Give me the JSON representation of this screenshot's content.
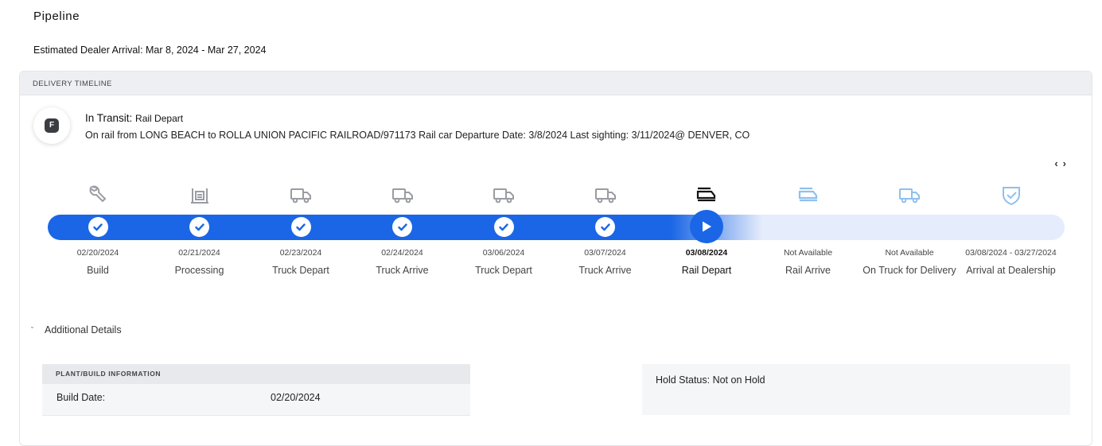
{
  "page": {
    "title": "Pipeline",
    "eta": "Estimated Dealer Arrival: Mar 8, 2024 - Mar 27, 2024"
  },
  "timeline": {
    "header": "DELIVERY TIMELINE",
    "status_letter": "F",
    "status_prefix": "In Transit:",
    "status_value": "Rail Depart",
    "status_detail": "On rail from LONG BEACH to ROLLA UNION PACIFIC RAILROAD/971173 Rail car Departure Date: 3/8/2024 Last sighting: 3/11/2024@ DENVER, CO",
    "nav": {
      "prev": "‹",
      "next": "›"
    },
    "steps": [
      {
        "date": "02/20/2024",
        "label": "Build",
        "state": "done",
        "icon": "wrench-icon"
      },
      {
        "date": "02/21/2024",
        "label": "Processing",
        "state": "done",
        "icon": "lift-icon"
      },
      {
        "date": "02/23/2024",
        "label": "Truck Depart",
        "state": "done",
        "icon": "truck-icon"
      },
      {
        "date": "02/24/2024",
        "label": "Truck Arrive",
        "state": "done",
        "icon": "truck-icon"
      },
      {
        "date": "03/06/2024",
        "label": "Truck Depart",
        "state": "done",
        "icon": "truck-icon"
      },
      {
        "date": "03/07/2024",
        "label": "Truck Arrive",
        "state": "done",
        "icon": "truck-icon"
      },
      {
        "date": "03/08/2024",
        "label": "Rail Depart",
        "state": "current",
        "icon": "train-icon"
      },
      {
        "date": "Not Available",
        "label": "Rail Arrive",
        "state": "future",
        "icon": "train-icon"
      },
      {
        "date": "Not Available",
        "label": "On Truck for Delivery",
        "state": "future",
        "icon": "truck-icon"
      },
      {
        "date": "03/08/2024 - 03/27/2024",
        "label": "Arrival at Dealership",
        "state": "future",
        "icon": "shield-check-icon"
      }
    ],
    "colors": {
      "accent": "#1a66e6",
      "track": "#e5ecfb",
      "done_icon": "#9a9ca2",
      "future_icon": "#8fc0ee",
      "current_icon": "#111111"
    }
  },
  "additional": {
    "toggle_label": "Additional Details",
    "plant": {
      "header": "PLANT/BUILD INFORMATION",
      "build_date_label": "Build Date:",
      "build_date_value": "02/20/2024"
    },
    "hold_status": "Hold Status: Not on Hold"
  }
}
